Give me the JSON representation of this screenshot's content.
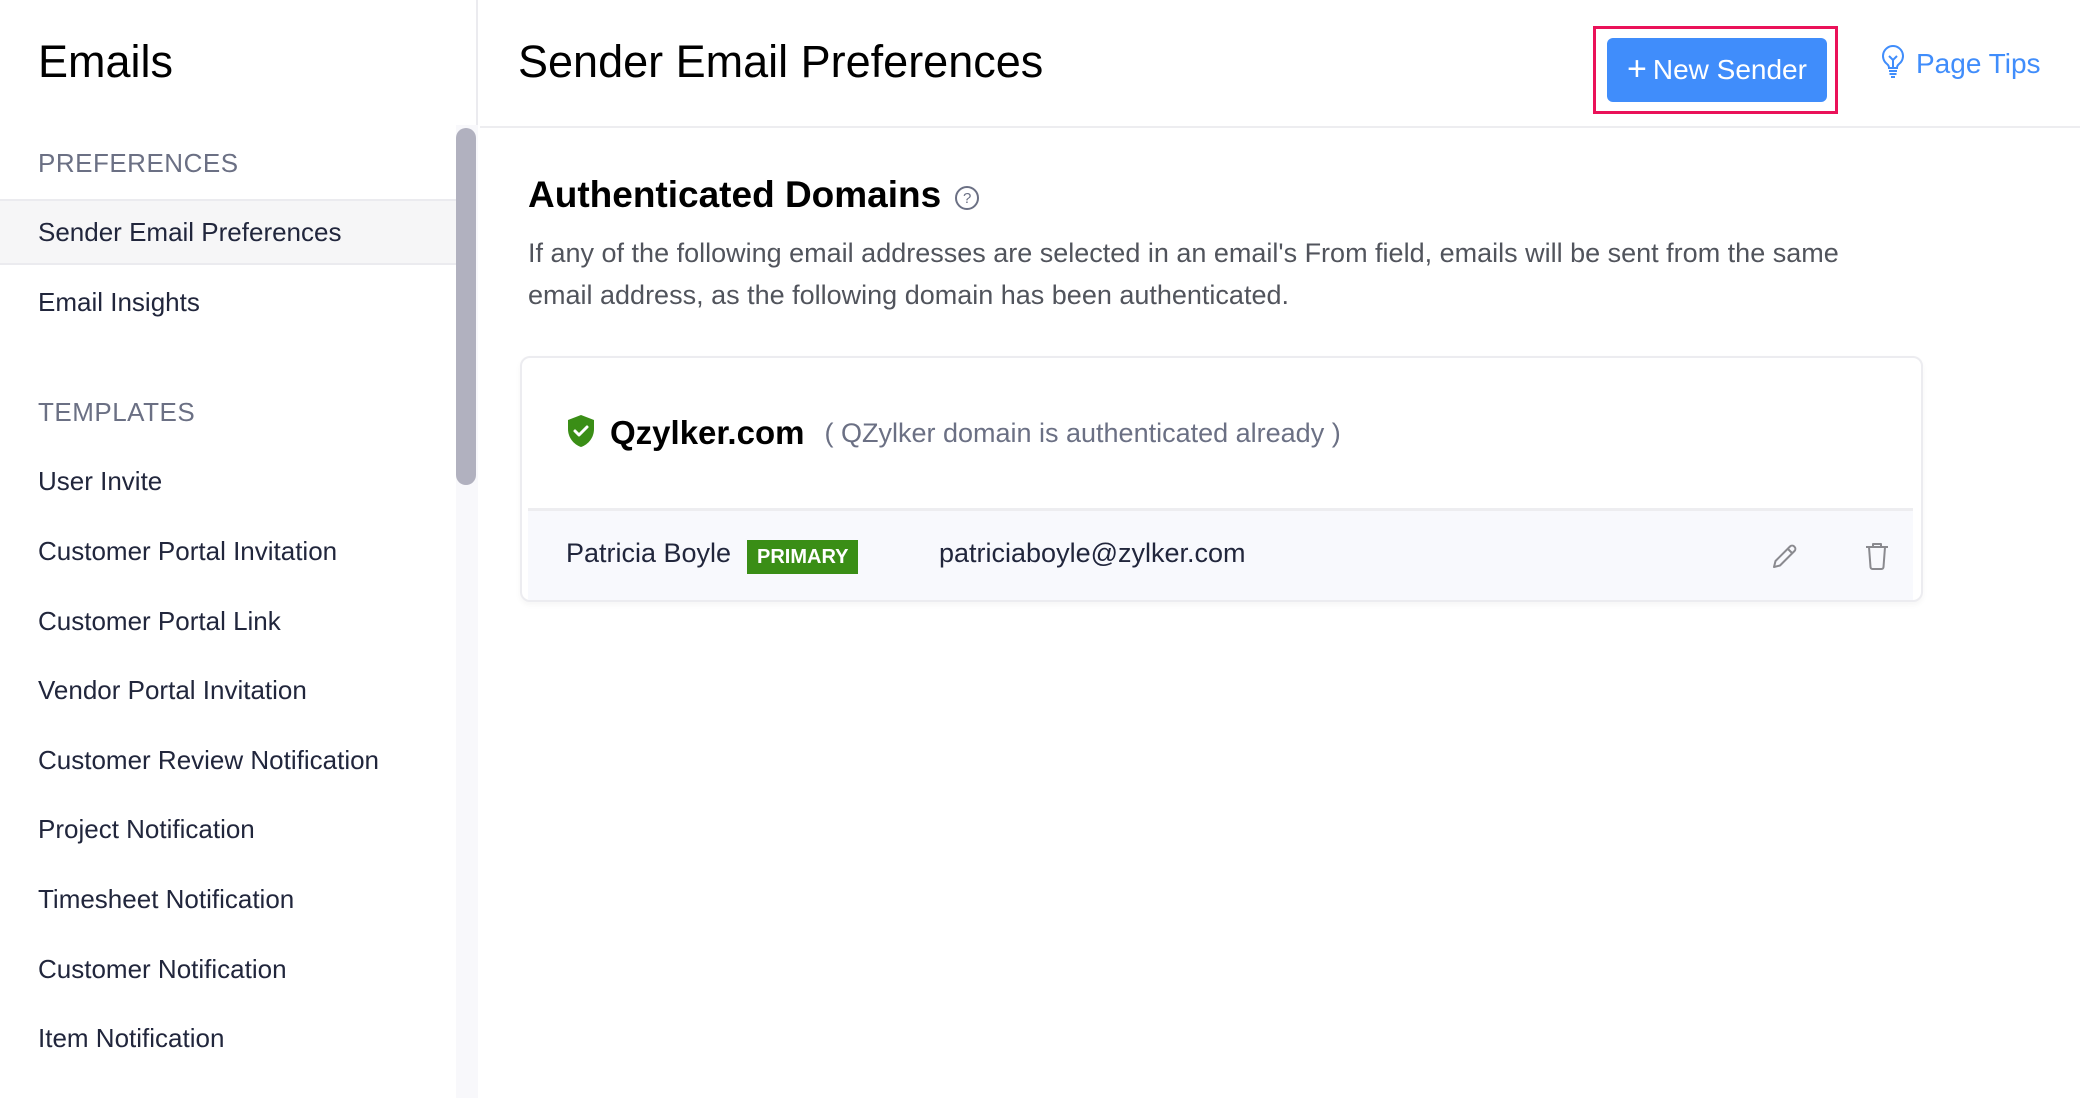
{
  "sidebar": {
    "title": "Emails",
    "sections": [
      {
        "label": "PREFERENCES",
        "items": [
          {
            "label": "Sender Email Preferences",
            "active": true
          },
          {
            "label": "Email Insights",
            "active": false
          }
        ]
      },
      {
        "label": "TEMPLATES",
        "items": [
          {
            "label": "User Invite"
          },
          {
            "label": "Customer Portal Invitation"
          },
          {
            "label": "Customer Portal Link"
          },
          {
            "label": "Vendor Portal Invitation"
          },
          {
            "label": "Customer Review Notification"
          },
          {
            "label": "Project Notification"
          },
          {
            "label": "Timesheet Notification"
          },
          {
            "label": "Customer Notification"
          },
          {
            "label": "Item Notification"
          }
        ]
      }
    ]
  },
  "header": {
    "title": "Sender Email Preferences",
    "new_sender_label": "New Sender",
    "new_sender_icon": "plus-icon",
    "page_tips_label": "Page Tips",
    "page_tips_icon": "lightbulb-icon"
  },
  "main": {
    "heading": "Authenticated Domains",
    "help_icon": "question-circle-icon",
    "help_glyph": "?",
    "description": "If any of the following email addresses are selected in an email's From field, emails will be sent from the same email address, as the following domain has been authenticated.",
    "domains": [
      {
        "name": "Qzylker.com",
        "status_icon": "shield-check-icon",
        "note": "( QZylker domain is authenticated already )",
        "senders": [
          {
            "name": "Patricia Boyle",
            "badge": "PRIMARY",
            "email": "patriciaboyle@zylker.com",
            "actions": [
              "edit-icon",
              "trash-icon"
            ]
          }
        ]
      }
    ]
  },
  "colors": {
    "accent": "#408dfb",
    "highlight": "#ea1259",
    "primary_badge": "#3a8e16",
    "shield": "#3a8e16"
  }
}
